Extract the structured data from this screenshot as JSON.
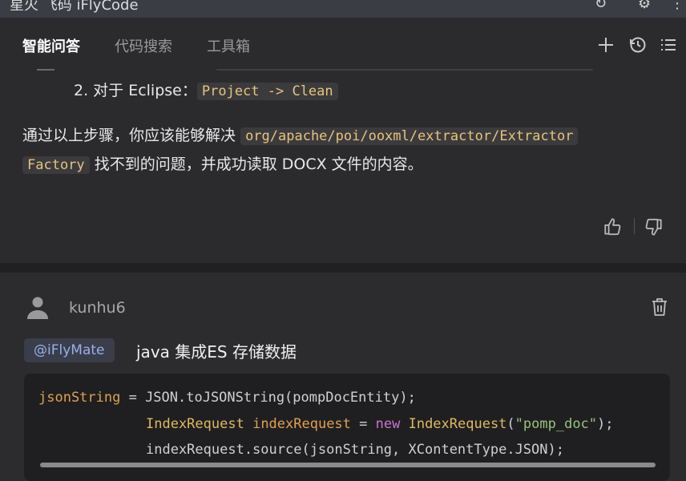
{
  "window": {
    "title": "星火 飞码 iFlyCode"
  },
  "tabs": [
    {
      "label": "智能问答",
      "active": true
    },
    {
      "label": "代码搜索",
      "active": false
    },
    {
      "label": "工具箱",
      "active": false
    }
  ],
  "tab_actions": {
    "add_icon": "plus-icon",
    "history_icon": "history-icon",
    "list_icon": "list-icon"
  },
  "answer": {
    "step_prefix": "2. 对于 Eclipse：",
    "step_code": "Project -> Clean",
    "conclusion_prefix": "通过以上步骤，你应该能够解决",
    "conclusion_code_line1": "org/apache/poi/ooxml/extractor/Extractor",
    "conclusion_code_line2": "Factory",
    "conclusion_suffix": "找不到的问题，并成功读取 DOCX 文件的内容。"
  },
  "question": {
    "username": "kunhu6",
    "mention": "@iFlyMate",
    "text": "java 集成ES 存储数据"
  },
  "code": {
    "line1": {
      "var": "jsonString",
      "rest": " = JSON.toJSONString(pompDocEntity);"
    },
    "line2": {
      "cls": "IndexRequest",
      "var": "indexRequest",
      "eq": " = ",
      "kw": "new",
      "cls2": "IndexRequest",
      "open": "(",
      "str": "\"pomp_doc\"",
      "close": ");"
    },
    "line3": "indexRequest.source(jsonString, XContentType.JSON);"
  },
  "colors": {
    "background": "#2b2b2d",
    "inline_code": "#e8c37a",
    "mention_bg": "#3a3d4a",
    "keyword": "#d070d0",
    "string": "#98c379"
  }
}
